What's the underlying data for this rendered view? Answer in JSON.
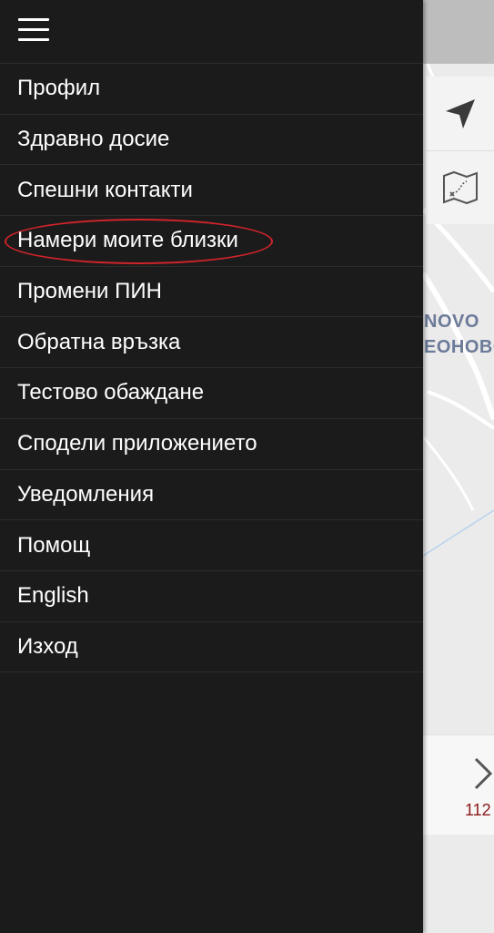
{
  "drawer": {
    "menu_icon": "hamburger-menu-icon",
    "items": [
      {
        "label": "Профил"
      },
      {
        "label": "Здравно досие"
      },
      {
        "label": "Спешни контакти"
      },
      {
        "label": "Намери моите близки",
        "highlighted": true
      },
      {
        "label": "Промени ПИН"
      },
      {
        "label": "Обратна връзка"
      },
      {
        "label": "Тестово обаждане"
      },
      {
        "label": "Сподели приложението"
      },
      {
        "label": "Уведомления"
      },
      {
        "label": "Помощ"
      },
      {
        "label": "English"
      },
      {
        "label": "Изход"
      }
    ],
    "highlight_color": "#d0242b"
  },
  "map": {
    "labels": [
      "NOVO",
      "EOHOBO"
    ],
    "controls": [
      "navigation-arrow-icon",
      "map-mode-icon"
    ],
    "bottom_panel": {
      "chevron_icon": "chevron-right-icon",
      "number": "112"
    }
  }
}
